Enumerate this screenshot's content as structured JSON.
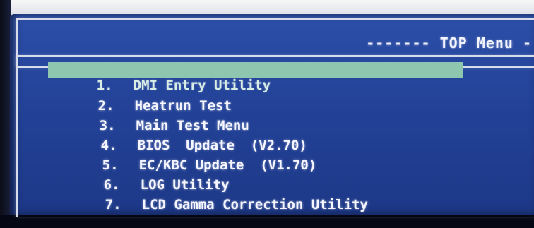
{
  "header": {
    "title": "------- TOP Menu -"
  },
  "menu": {
    "items": [
      {
        "num": "1.",
        "label": "DMI Entry Utility"
      },
      {
        "num": "2.",
        "label": "Heatrun Test"
      },
      {
        "num": "3.",
        "label": "Main Test Menu"
      },
      {
        "num": "4.",
        "label": "BIOS  Update  (V2.70)"
      },
      {
        "num": "5.",
        "label": "EC/KBC Update  (V1.70)"
      },
      {
        "num": "6.",
        "label": "LOG Utility"
      },
      {
        "num": "7.",
        "label": "LCD Gamma Correction Utility"
      }
    ],
    "selected_index": 0
  },
  "colors": {
    "background": "#234298",
    "highlight": "#8fc6b0",
    "text": "#f5f6ff"
  }
}
